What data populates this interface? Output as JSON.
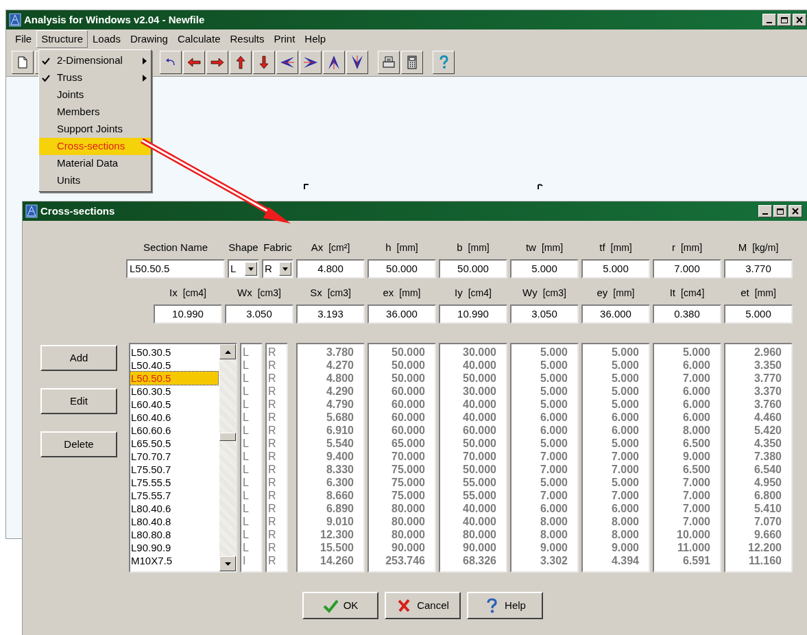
{
  "app_window": {
    "title": "Analysis for Windows v2.04 - Newfile"
  },
  "menu_bar": [
    {
      "label": "File",
      "selected": false
    },
    {
      "label": "Structure",
      "selected": true
    },
    {
      "label": "Loads",
      "selected": false
    },
    {
      "label": "Drawing",
      "selected": false
    },
    {
      "label": "Calculate",
      "selected": false
    },
    {
      "label": "Results",
      "selected": false
    },
    {
      "label": "Print",
      "selected": false
    },
    {
      "label": "Help",
      "selected": false
    }
  ],
  "structure_menu": [
    {
      "label": "2-Dimensional",
      "checked": true,
      "submenu": true,
      "selected": false
    },
    {
      "label": "Truss",
      "checked": true,
      "submenu": true,
      "selected": false
    },
    {
      "label": "Joints",
      "checked": false,
      "submenu": false,
      "selected": false
    },
    {
      "label": "Members",
      "checked": false,
      "submenu": false,
      "selected": false
    },
    {
      "label": "Support Joints",
      "checked": false,
      "submenu": false,
      "selected": false
    },
    {
      "label": "Cross-sections",
      "checked": false,
      "submenu": false,
      "selected": true
    },
    {
      "label": "Material Data",
      "checked": false,
      "submenu": false,
      "selected": false
    },
    {
      "label": "Units",
      "checked": false,
      "submenu": false,
      "selected": false
    }
  ],
  "dialog": {
    "title": "Cross-sections",
    "fields_row_1": [
      {
        "kind": "text",
        "label": "Section Name",
        "value": "L50.50.5"
      },
      {
        "kind": "combo",
        "label": "Shape",
        "value": "L"
      },
      {
        "kind": "combo",
        "label": "Fabric",
        "value": "R"
      },
      {
        "kind": "number",
        "label": "Ax",
        "unit": "[cm²]",
        "value": "4.800"
      },
      {
        "kind": "number",
        "label": "h",
        "unit": "[mm]",
        "value": "50.000"
      },
      {
        "kind": "number",
        "label": "b",
        "unit": "[mm]",
        "value": "50.000"
      },
      {
        "kind": "number",
        "label": "tw",
        "unit": "[mm]",
        "value": "5.000"
      },
      {
        "kind": "number",
        "label": "tf",
        "unit": "[mm]",
        "value": "5.000"
      },
      {
        "kind": "number",
        "label": "r",
        "unit": "[mm]",
        "value": "7.000"
      },
      {
        "kind": "number",
        "label": "M",
        "unit": "[kg/m]",
        "value": "3.770"
      }
    ],
    "fields_row_2": [
      {
        "label": "Ix",
        "unit": "[cm4]",
        "value": "10.990"
      },
      {
        "label": "Wx",
        "unit": "[cm3]",
        "value": "3.050"
      },
      {
        "label": "Sx",
        "unit": "[cm3]",
        "value": "3.193"
      },
      {
        "label": "ex",
        "unit": "[mm]",
        "value": "36.000"
      },
      {
        "label": "Iy",
        "unit": "[cm4]",
        "value": "10.990"
      },
      {
        "label": "Wy",
        "unit": "[cm3]",
        "value": "3.050"
      },
      {
        "label": "ey",
        "unit": "[mm]",
        "value": "36.000"
      },
      {
        "label": "It",
        "unit": "[cm4]",
        "value": "0.380"
      },
      {
        "label": "et",
        "unit": "[mm]",
        "value": "5.000"
      }
    ],
    "side_buttons": [
      "Add",
      "Edit",
      "Delete"
    ],
    "sections_list": [
      {
        "selected": false,
        "cells": [
          "L50.30.5",
          "L",
          "R",
          "3.780",
          "50.000",
          "30.000",
          "5.000",
          "5.000",
          "5.000",
          "2.960"
        ]
      },
      {
        "selected": false,
        "cells": [
          "L50.40.5",
          "L",
          "R",
          "4.270",
          "50.000",
          "40.000",
          "5.000",
          "5.000",
          "6.000",
          "3.350"
        ]
      },
      {
        "selected": true,
        "cells": [
          "L50.50.5",
          "L",
          "R",
          "4.800",
          "50.000",
          "50.000",
          "5.000",
          "5.000",
          "7.000",
          "3.770"
        ]
      },
      {
        "selected": false,
        "cells": [
          "L60.30.5",
          "L",
          "R",
          "4.290",
          "60.000",
          "30.000",
          "5.000",
          "5.000",
          "6.000",
          "3.370"
        ]
      },
      {
        "selected": false,
        "cells": [
          "L60.40.5",
          "L",
          "R",
          "4.790",
          "60.000",
          "40.000",
          "5.000",
          "5.000",
          "6.000",
          "3.760"
        ]
      },
      {
        "selected": false,
        "cells": [
          "L60.40.6",
          "L",
          "R",
          "5.680",
          "60.000",
          "40.000",
          "6.000",
          "6.000",
          "6.000",
          "4.460"
        ]
      },
      {
        "selected": false,
        "cells": [
          "L60.60.6",
          "L",
          "R",
          "6.910",
          "60.000",
          "60.000",
          "6.000",
          "6.000",
          "8.000",
          "5.420"
        ]
      },
      {
        "selected": false,
        "cells": [
          "L65.50.5",
          "L",
          "R",
          "5.540",
          "65.000",
          "50.000",
          "5.000",
          "5.000",
          "6.500",
          "4.350"
        ]
      },
      {
        "selected": false,
        "cells": [
          "L70.70.7",
          "L",
          "R",
          "9.400",
          "70.000",
          "70.000",
          "7.000",
          "7.000",
          "9.000",
          "7.380"
        ]
      },
      {
        "selected": false,
        "cells": [
          "L75.50.7",
          "L",
          "R",
          "8.330",
          "75.000",
          "50.000",
          "7.000",
          "7.000",
          "6.500",
          "6.540"
        ]
      },
      {
        "selected": false,
        "cells": [
          "L75.55.5",
          "L",
          "R",
          "6.300",
          "75.000",
          "55.000",
          "5.000",
          "5.000",
          "7.000",
          "4.950"
        ]
      },
      {
        "selected": false,
        "cells": [
          "L75.55.7",
          "L",
          "R",
          "8.660",
          "75.000",
          "55.000",
          "7.000",
          "7.000",
          "7.000",
          "6.800"
        ]
      },
      {
        "selected": false,
        "cells": [
          "L80.40.6",
          "L",
          "R",
          "6.890",
          "80.000",
          "40.000",
          "6.000",
          "6.000",
          "7.000",
          "5.410"
        ]
      },
      {
        "selected": false,
        "cells": [
          "L80.40.8",
          "L",
          "R",
          "9.010",
          "80.000",
          "40.000",
          "8.000",
          "8.000",
          "7.000",
          "7.070"
        ]
      },
      {
        "selected": false,
        "cells": [
          "L80.80.8",
          "L",
          "R",
          "12.300",
          "80.000",
          "80.000",
          "8.000",
          "8.000",
          "10.000",
          "9.660"
        ]
      },
      {
        "selected": false,
        "cells": [
          "L90.90.9",
          "L",
          "R",
          "15.500",
          "90.000",
          "90.000",
          "9.000",
          "9.000",
          "11.000",
          "12.200"
        ]
      },
      {
        "selected": false,
        "cells": [
          "M10X7.5",
          "I",
          "R",
          "14.260",
          "253.746",
          "68.326",
          "3.302",
          "4.394",
          "6.591",
          "11.160"
        ]
      }
    ],
    "footer_buttons": [
      {
        "kind": "ok",
        "label": "OK"
      },
      {
        "kind": "cancel",
        "label": "Cancel"
      },
      {
        "kind": "help",
        "label": "Help"
      }
    ]
  }
}
